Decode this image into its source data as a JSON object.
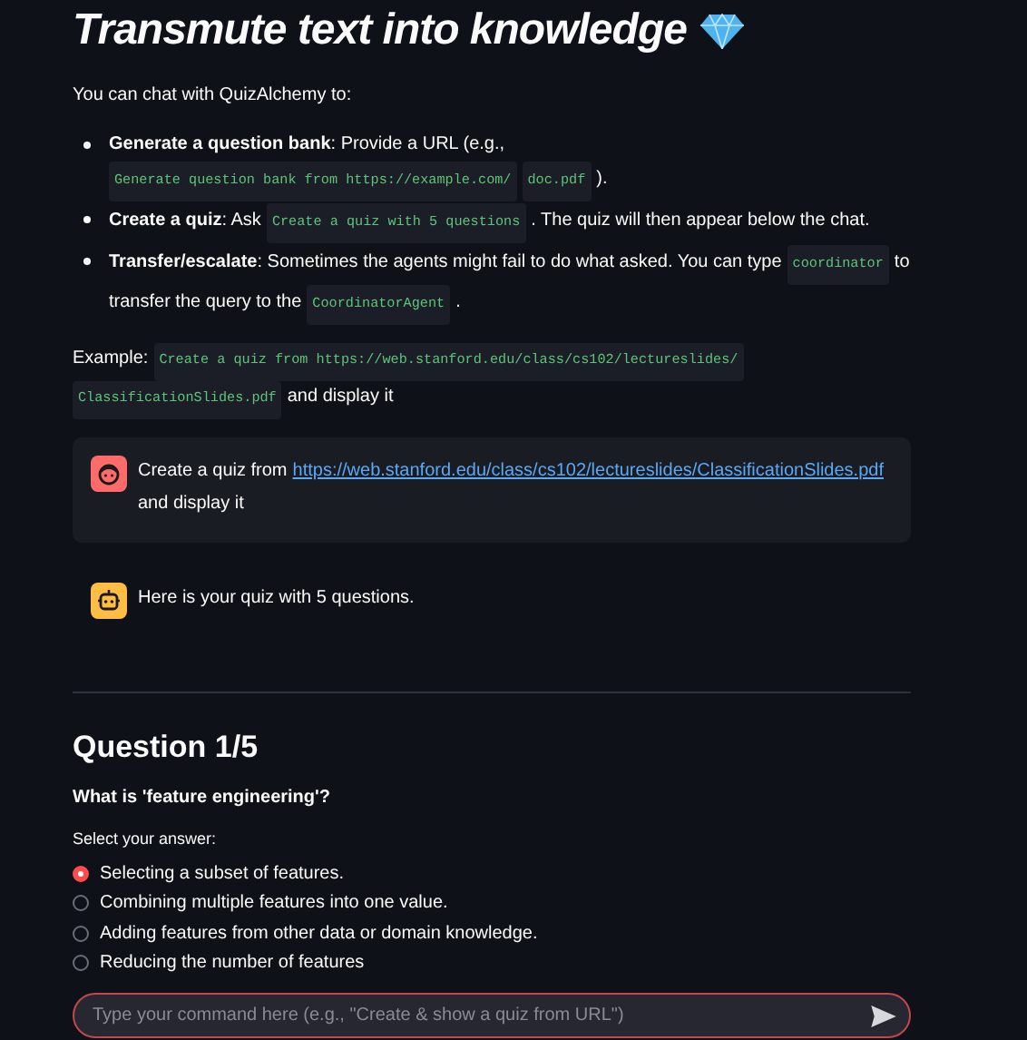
{
  "title": "Transmute text into knowledge",
  "intro": "You can chat with QuizAlchemy to:",
  "bullets": [
    [
      {
        "kind": "text",
        "text": "**Generate a question bank**: Provide a URL (e.g.,"
      },
      {
        "kind": "code",
        "text": "Generate question bank from https://example.com/"
      },
      {
        "kind": "code",
        "text": "doc.pdf"
      },
      {
        "kind": "text",
        "text": ")."
      }
    ],
    [
      {
        "kind": "text",
        "text": "**Create a quiz**: Ask"
      },
      {
        "kind": "code",
        "text": "Create a quiz with 5 questions"
      },
      {
        "kind": "text",
        "text": ". The quiz will then appear below the chat."
      }
    ],
    [
      {
        "kind": "text",
        "text": "**Transfer/escalate**: Sometimes the agents might fail to do what asked. You can type"
      },
      {
        "kind": "code",
        "text": "coordinator"
      },
      {
        "kind": "text",
        "text": "to"
      },
      {
        "kind": "text",
        "text": "transfer the query to the"
      },
      {
        "kind": "code",
        "text": "CoordinatorAgent"
      },
      {
        "kind": "text",
        "text": "."
      }
    ]
  ],
  "example": [
    {
      "kind": "text",
      "text": "Example:"
    },
    {
      "kind": "code",
      "text": "Create a quiz from  https://web.stanford.edu/class/cs102/lectureslides/"
    },
    {
      "kind": "code",
      "text": "ClassificationSlides.pdf"
    },
    {
      "kind": "text",
      "text": "and display it"
    }
  ],
  "messages": [
    {
      "kind": "user",
      "text": "Create a quiz from",
      "link": "https://web.stanford.edu/class/cs102/lectureslides/ClassificationSlides.pdf",
      "after": "and display it"
    },
    {
      "kind": "assistant",
      "text": "Here is your quiz with 5 questions."
    }
  ],
  "quiz": {
    "heading": "Question 1/5",
    "question": "What is 'feature engineering'?",
    "prompt": "Select your answer:",
    "options": [
      {
        "label": "Selecting a subset of features.",
        "selected": true
      },
      {
        "label": "Combining multiple features into one value.",
        "selected": false
      },
      {
        "label": "Adding features from other data or domain knowledge.",
        "selected": false
      },
      {
        "label": "Reducing the number of features",
        "selected": false
      }
    ]
  },
  "chat_input": {
    "placeholder": "Type your command here (e.g., \"Create & show a quiz from URL\")"
  }
}
